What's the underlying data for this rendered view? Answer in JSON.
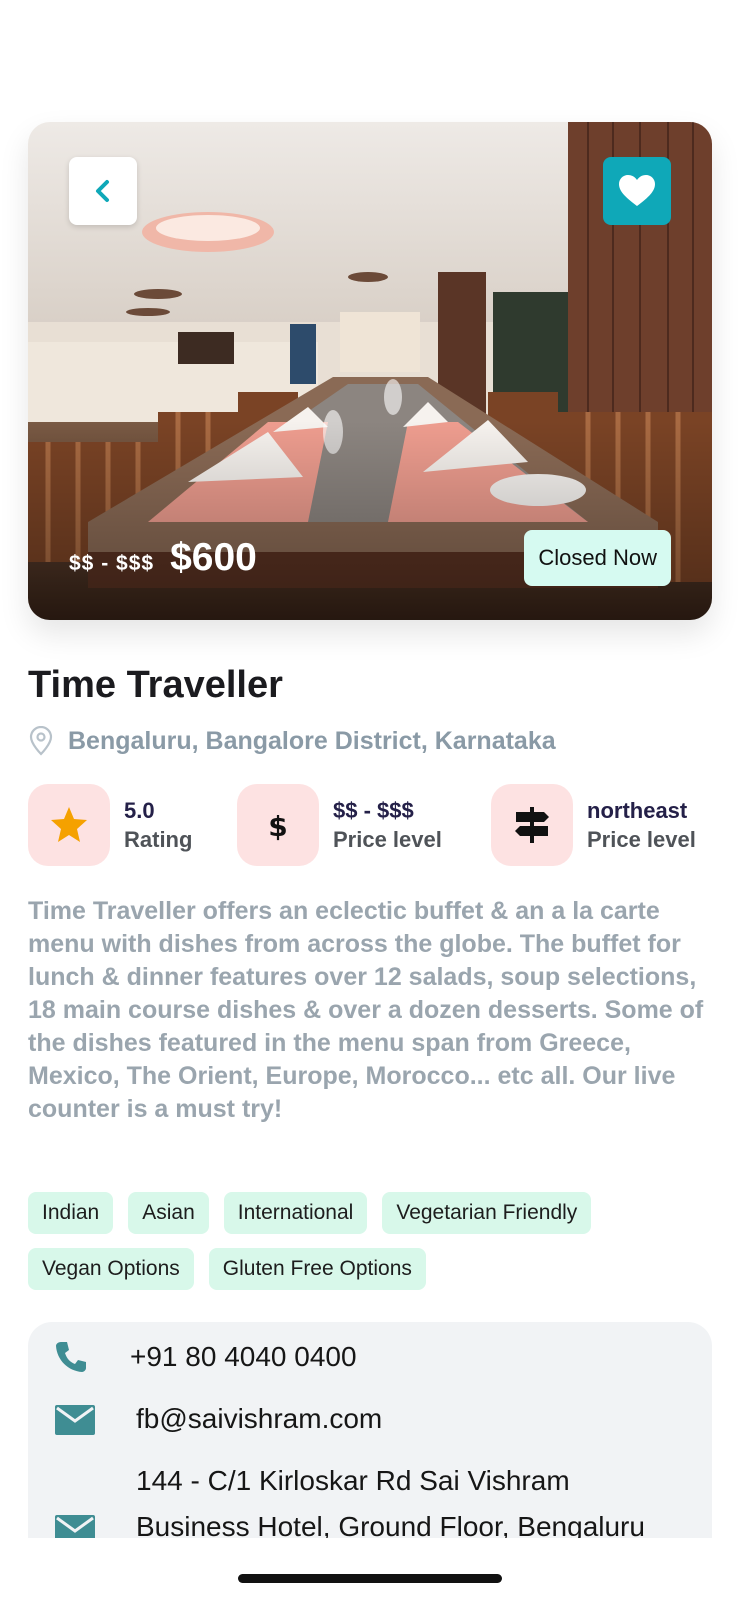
{
  "hero": {
    "price_level": "$$ - $$$",
    "price": "$600",
    "status": "Closed Now"
  },
  "restaurant": {
    "name": "Time Traveller",
    "location": "Bengaluru, Bangalore District, Karnataka"
  },
  "stats": [
    {
      "icon": "star-icon",
      "value": "5.0",
      "label": "Rating"
    },
    {
      "icon": "dollar-icon",
      "value": "$$ - $$$",
      "label": "Price level"
    },
    {
      "icon": "signpost-icon",
      "value": "northeast",
      "label": "Price level"
    }
  ],
  "description": "Time Traveller offers an eclectic buffet & an a la carte menu with dishes from across the globe. The buffet for lunch & dinner features over 12 salads, soup selections, 18 main course dishes & over a dozen desserts. Some of the dishes featured in the menu span from Greece, Mexico, The Orient, Europe, Morocco... etc all. Our live counter is a must try!",
  "tags": [
    "Indian",
    "Asian",
    "International",
    "Vegetarian Friendly",
    "Vegan Options",
    "Gluten Free Options"
  ],
  "contact": {
    "phone": "+91 80 4040 0400",
    "email": "fb@saivishram.com",
    "address_line1": "144 - C/1 Kirloskar Rd Sai Vishram",
    "address_line2": "Business Hotel, Ground Floor, Bengaluru"
  },
  "colors": {
    "accent": "#0fa8b8",
    "tag_bg": "#d8f8ea",
    "stat_icon_bg": "#fde2e2",
    "star": "#f5a100",
    "contact_icon": "#3f8d93"
  }
}
